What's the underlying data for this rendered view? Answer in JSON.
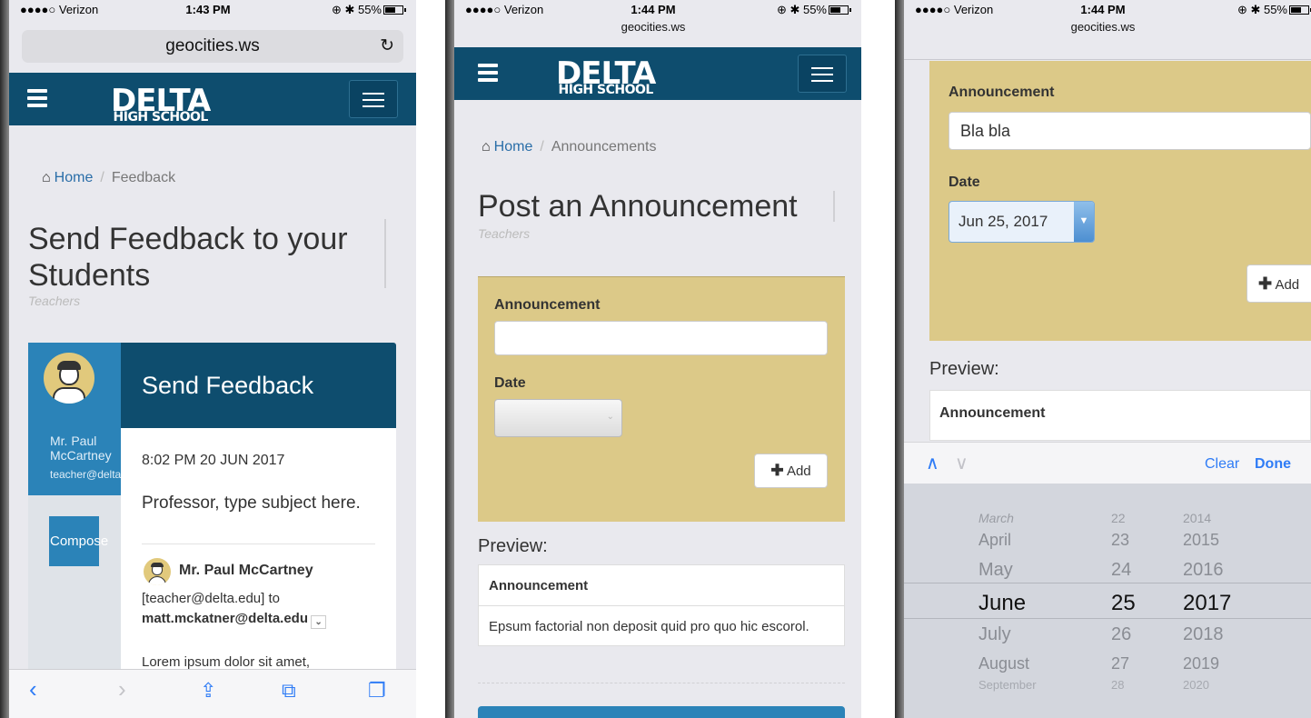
{
  "screens": [
    {
      "status": {
        "carrier": "●●●●○ Verizon",
        "time": "1:43 PM",
        "battery": "55%"
      },
      "url": "geocities.ws",
      "logo": {
        "big": "DELTA",
        "small": "HIGH SCHOOL"
      },
      "breadcrumb": {
        "home": "Home",
        "current": "Feedback"
      },
      "title": "Send Feedback to your Students",
      "subtitle": "Teachers",
      "sidebar": {
        "name": "Mr. Paul McCartney",
        "email": "teacher@delta.edu",
        "compose": "Compose"
      },
      "panel_title": "Send Feedback",
      "message": {
        "date": "8:02 PM 20 JUN 2017",
        "subject": "Professor, type subject here.",
        "from": "Mr. Paul McCartney",
        "from_email": "[teacher@delta.edu] to",
        "to": "matt.mckatner@delta.edu",
        "body": "Lorem ipsum dolor sit amet,"
      }
    },
    {
      "status": {
        "carrier": "●●●●○ Verizon",
        "time": "1:44 PM",
        "battery": "55%"
      },
      "url": "geocities.ws",
      "logo": {
        "big": "DELTA",
        "small": "HIGH SCHOOL"
      },
      "breadcrumb": {
        "home": "Home",
        "current": "Announcements"
      },
      "title": "Post an Announcement",
      "subtitle": "Teachers",
      "form": {
        "announcement_label": "Announcement",
        "announcement_value": "",
        "date_label": "Date",
        "add": "Add"
      },
      "preview": {
        "heading": "Preview:",
        "col": "Announcement",
        "row": "Epsum factorial non deposit quid pro quo hic escorol."
      }
    },
    {
      "status": {
        "carrier": "●●●●○ Verizon",
        "time": "1:44 PM",
        "battery": "55%"
      },
      "url": "geocities.ws",
      "form": {
        "announcement_label": "Announcement",
        "announcement_value": "Bla bla",
        "date_label": "Date",
        "date_value": "Jun 25, 2017",
        "add": "Add"
      },
      "preview": {
        "heading": "Preview:",
        "col": "Announcement"
      },
      "picker": {
        "clear": "Clear",
        "done": "Done",
        "months": [
          "March",
          "April",
          "May",
          "June",
          "July",
          "August",
          "September"
        ],
        "days": [
          "22",
          "23",
          "24",
          "25",
          "26",
          "27",
          "28"
        ],
        "years": [
          "2014",
          "2015",
          "2016",
          "2017",
          "2018",
          "2019",
          "2020"
        ]
      }
    }
  ],
  "colors": {
    "nav": "#0e4d6e",
    "accent": "#2b83b8",
    "well": "#dcc988",
    "ios_blue": "#2f7cf6"
  }
}
